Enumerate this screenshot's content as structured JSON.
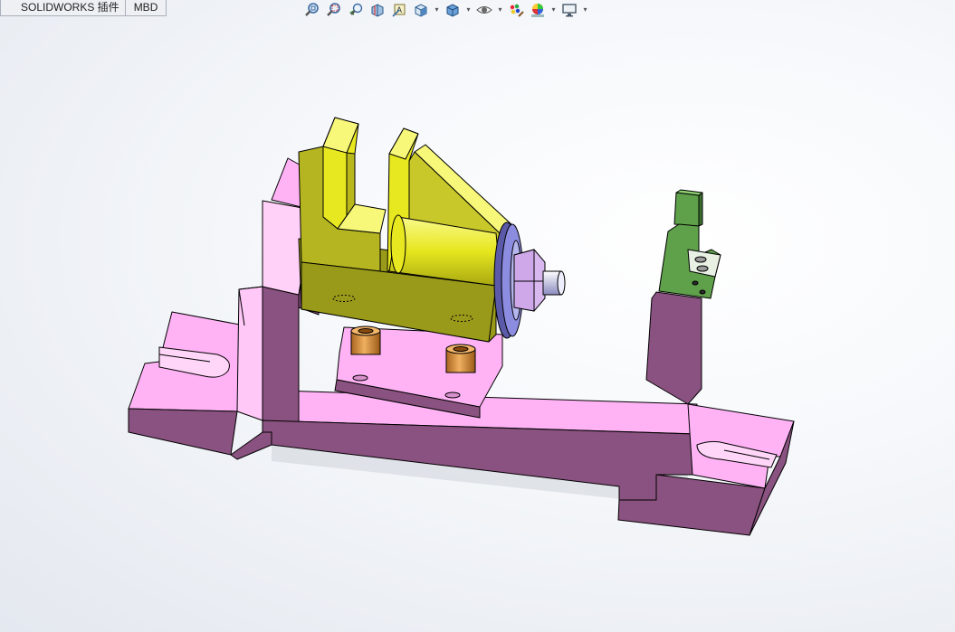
{
  "command_manager": {
    "tabs": [
      {
        "label": "SOLIDWORKS 插件"
      },
      {
        "label": "MBD"
      }
    ]
  },
  "heads_up_toolbar": {
    "tools": [
      {
        "icon": "zoom-to-fit-icon",
        "has_dropdown": false
      },
      {
        "icon": "zoom-to-area-icon",
        "has_dropdown": false
      },
      {
        "icon": "previous-view-icon",
        "has_dropdown": false
      },
      {
        "icon": "section-view-icon",
        "has_dropdown": false
      },
      {
        "icon": "dynamic-annotation-views-icon",
        "has_dropdown": false
      },
      {
        "icon": "view-orientation-icon",
        "has_dropdown": true
      },
      {
        "icon": "display-style-icon",
        "has_dropdown": true
      },
      {
        "icon": "hide-show-items-icon",
        "has_dropdown": true
      },
      {
        "icon": "edit-appearance-icon",
        "has_dropdown": false
      },
      {
        "icon": "apply-scene-icon",
        "has_dropdown": true
      },
      {
        "icon": "view-settings-icon",
        "has_dropdown": true
      }
    ]
  },
  "model": {
    "colors": {
      "base_top": "#ffb3f5",
      "base_side": "#8a5280",
      "base_front": "#b37aa6",
      "clamp_yellow_light": "#f7f77a",
      "clamp_yellow_mid": "#e8e820",
      "clamp_yellow_dark": "#9a9a1a",
      "flange_blue": "#8c8ce0",
      "bushing_orange": "#e0a050",
      "locator_green": "#5fa04a"
    }
  }
}
